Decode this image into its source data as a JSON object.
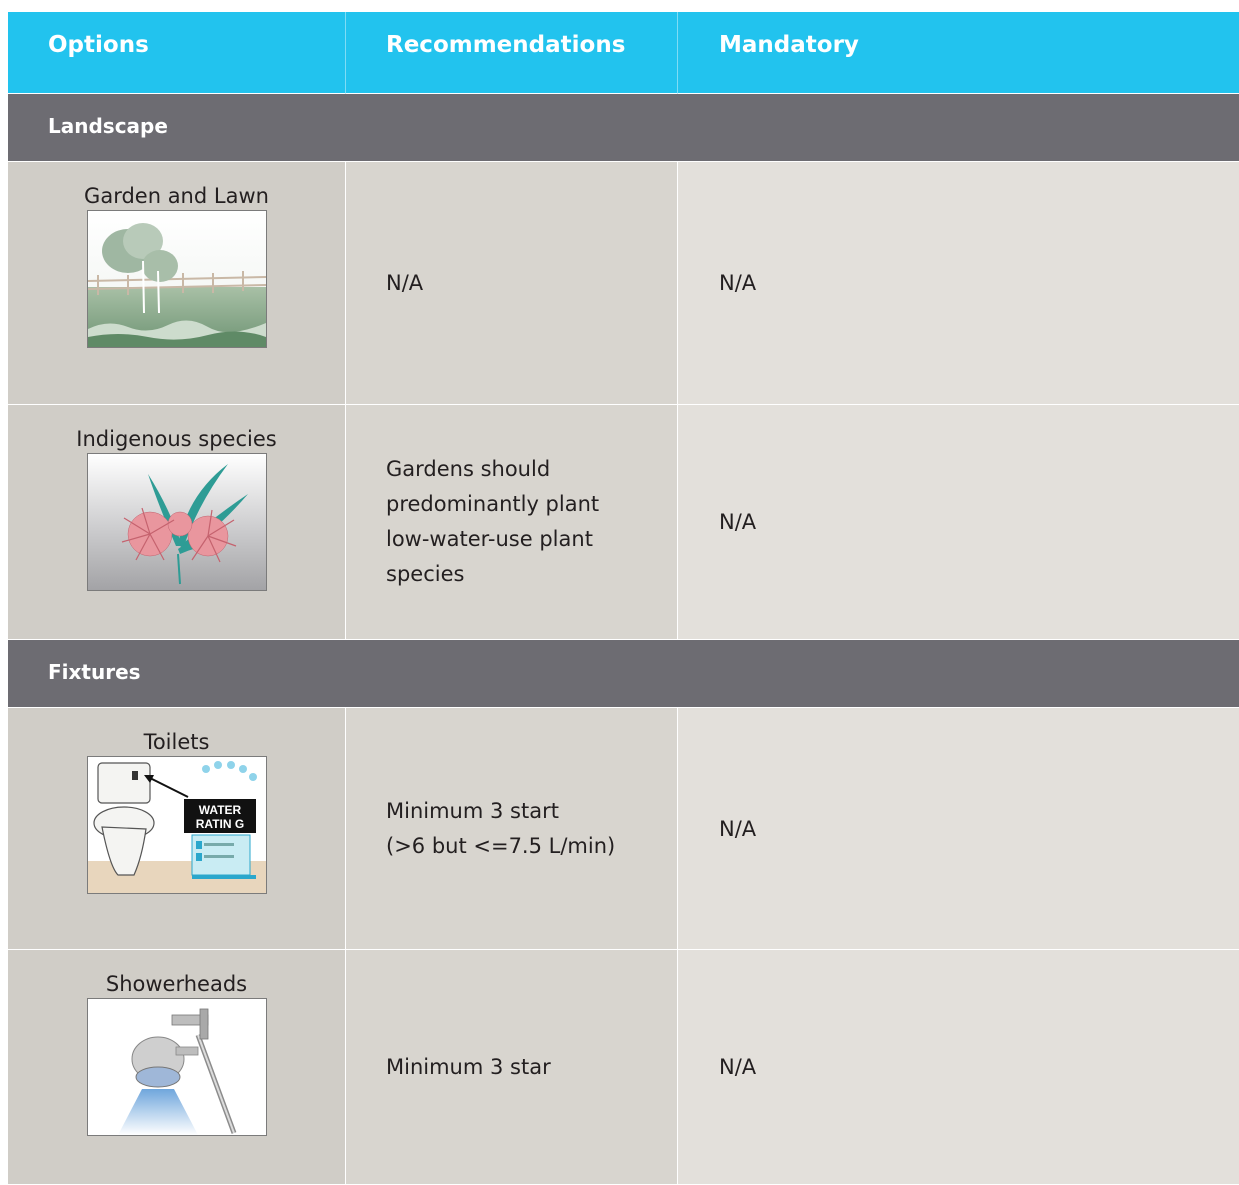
{
  "header": {
    "col1": "Options",
    "col2": "Recommendations",
    "col3": "Mandatory"
  },
  "sections": [
    {
      "title": "Landscape",
      "rows": [
        {
          "option": "Garden and Lawn",
          "icon": "garden-lawn-illustration",
          "recommendation": "N/A",
          "mandatory": "N/A"
        },
        {
          "option": "Indigenous species",
          "icon": "indigenous-flower-illustration",
          "recommendation": "Gardens should predominantly plant low-water-use plant species",
          "mandatory": "N/A"
        }
      ]
    },
    {
      "title": "Fixtures",
      "rows": [
        {
          "option": "Toilets",
          "icon": "toilet-water-rating-illustration",
          "recommendation_line1": "Minimum 3 start",
          "recommendation_line2": "(>6 but <=7.5 L/min)",
          "mandatory": "N/A",
          "label_line1": "WATER",
          "label_line2": "RATIN G"
        },
        {
          "option": "Showerheads",
          "icon": "showerhead-illustration",
          "recommendation": "Minimum 3 star",
          "mandatory": "N/A"
        }
      ]
    }
  ],
  "colors": {
    "header": "#22c3ee",
    "section": "#6d6c72",
    "option_cell": "#d0cdc7",
    "rec_cell": "#d8d5cf",
    "mand_cell": "#e3e0db"
  }
}
